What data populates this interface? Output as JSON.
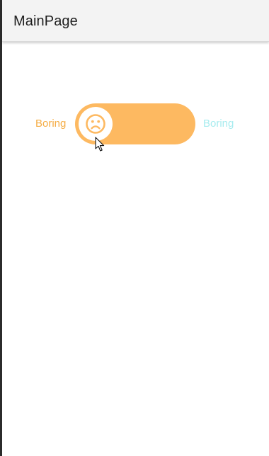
{
  "app": {
    "title": "MainPage"
  },
  "toggle": {
    "left_label": "Boring",
    "right_label": "Boring",
    "state": "off",
    "thumb_icon": "sad-face-icon",
    "colors": {
      "track": "#fdb961",
      "left_label": "#f5ad45",
      "right_label": "#a7ecef",
      "thumb": "#ffffff"
    }
  }
}
